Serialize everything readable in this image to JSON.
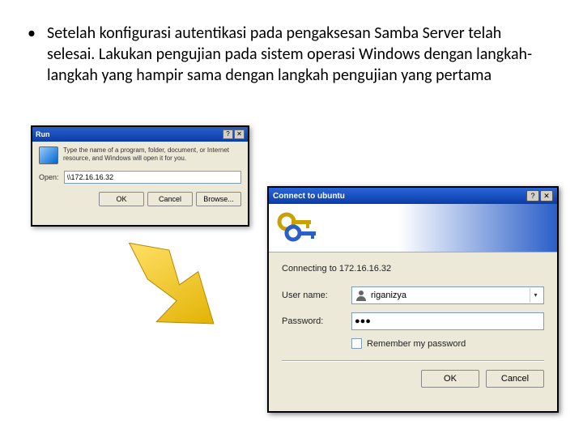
{
  "bullet": "Setelah konfigurasi autentikasi pada pengaksesan Samba Server telah selesai. Lakukan pengujian pada sistem operasi Windows dengan langkah-langkah yang hampir sama dengan langkah pengujian yang pertama",
  "run": {
    "title": "Run",
    "description": "Type the name of a program, folder, document, or Internet resource, and Windows will open it for you.",
    "open_label": "Open:",
    "open_value": "\\\\172.16.16.32",
    "ok": "OK",
    "cancel": "Cancel",
    "browse": "Browse..."
  },
  "connect": {
    "title": "Connect to ubuntu",
    "connecting": "Connecting to 172.16.16.32",
    "user_label": "User name:",
    "user_value": "riganizya",
    "pass_label": "Password:",
    "pass_value": "●●●",
    "remember": "Remember my password",
    "ok": "OK",
    "cancel": "Cancel"
  }
}
